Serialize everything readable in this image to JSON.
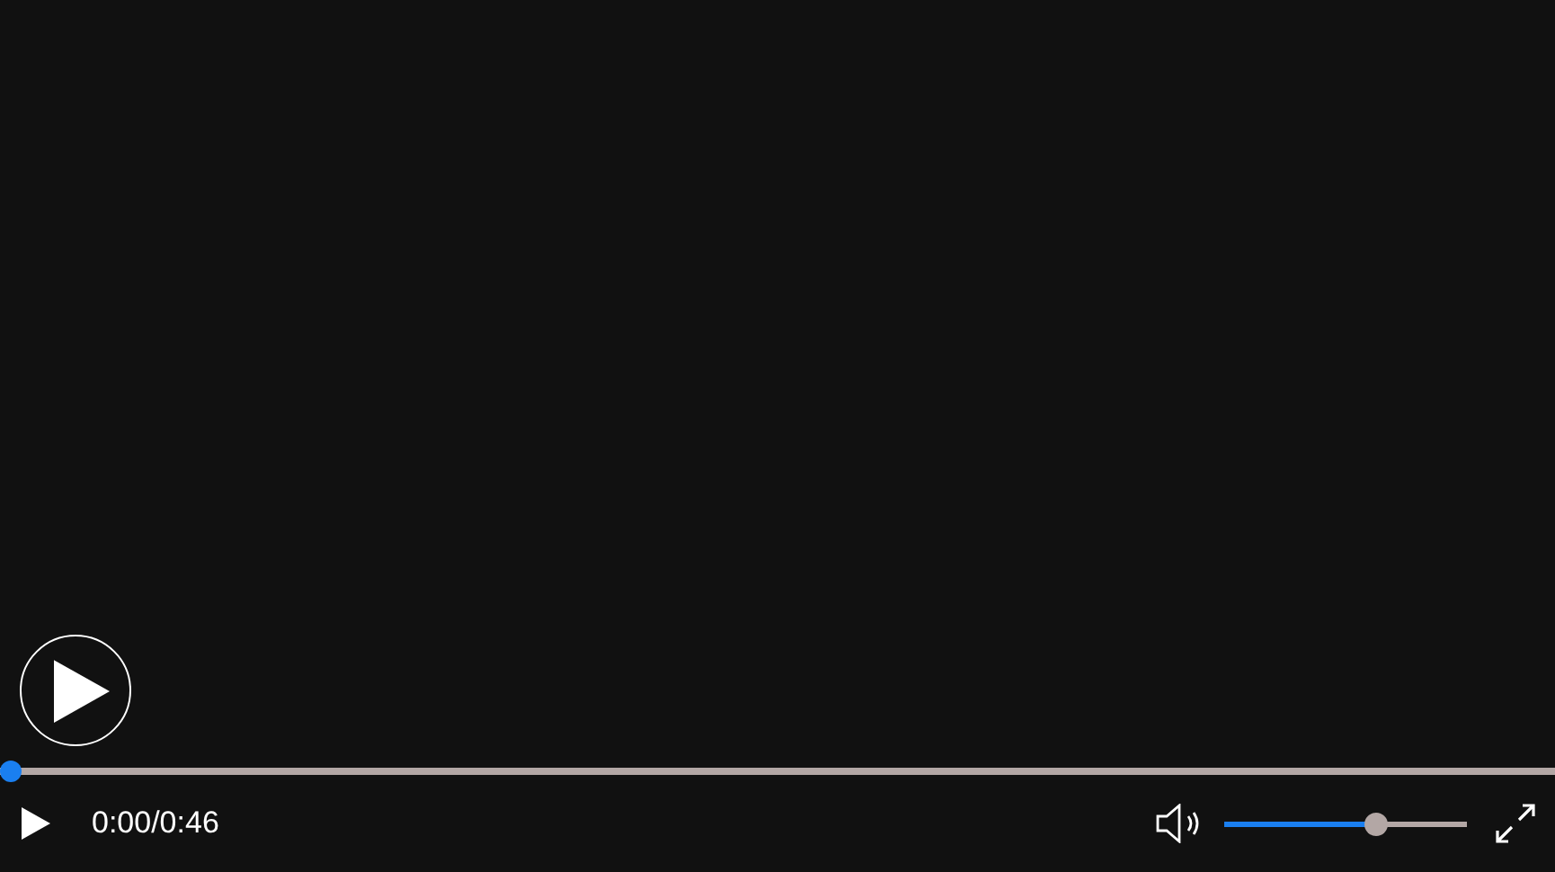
{
  "player": {
    "playing": false,
    "progress": {
      "level": 0
    },
    "time": "0:00/0:46",
    "volume": {
      "muted": false,
      "level": 0.64
    }
  }
}
